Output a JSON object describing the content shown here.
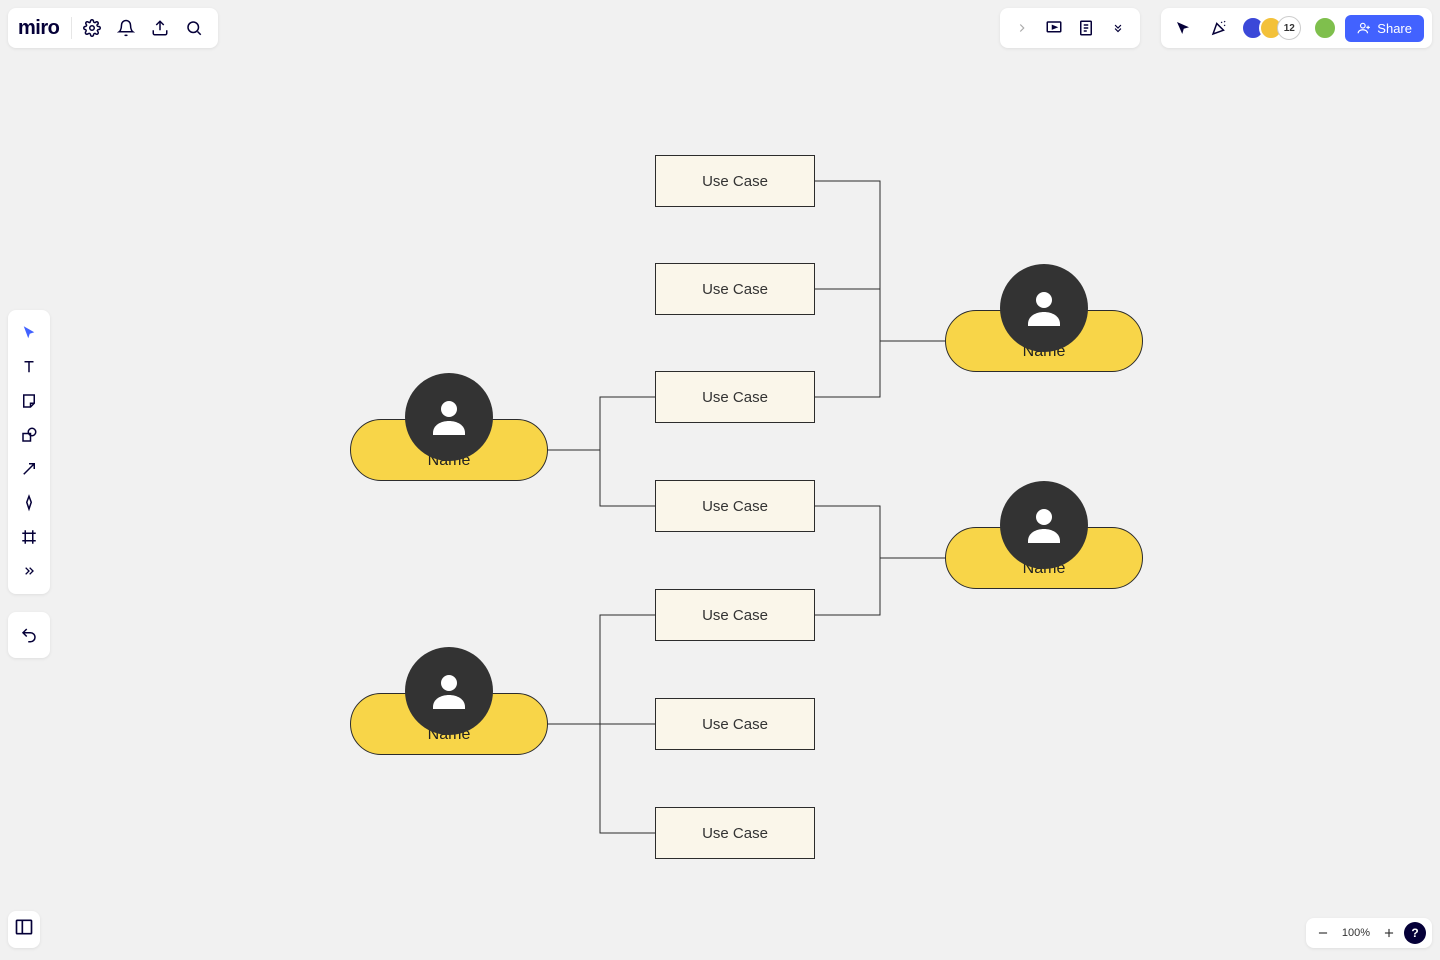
{
  "app": {
    "logo": "miro"
  },
  "toolbar": {
    "share_label": "Share"
  },
  "zoom": {
    "level": "100%"
  },
  "avatars": {
    "overflow_count": "12"
  },
  "diagram": {
    "actors": [
      {
        "label": "Name"
      },
      {
        "label": "Name"
      },
      {
        "label": "Name"
      },
      {
        "label": "Name"
      }
    ],
    "usecases": [
      {
        "label": "Use Case"
      },
      {
        "label": "Use Case"
      },
      {
        "label": "Use Case"
      },
      {
        "label": "Use Case"
      },
      {
        "label": "Use Case"
      },
      {
        "label": "Use Case"
      },
      {
        "label": "Use Case"
      }
    ]
  }
}
